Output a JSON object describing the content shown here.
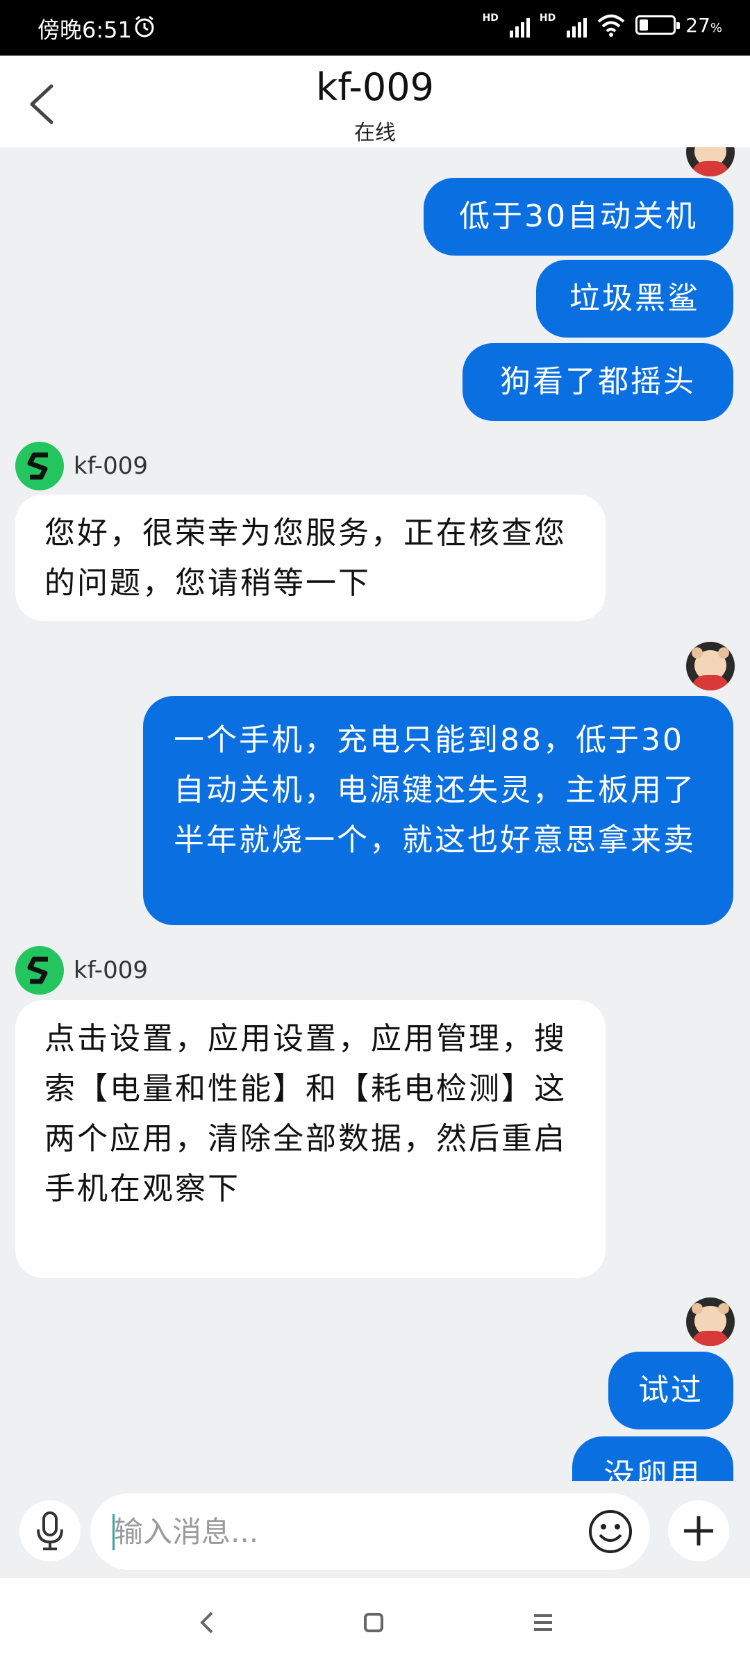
{
  "status": {
    "time": "傍晚6:51",
    "network_1": "HD",
    "network_2": "HD",
    "battery": "27",
    "battery_unit": "%",
    "battery_level": 0.27
  },
  "header": {
    "title": "kf-009",
    "subtitle": "在线"
  },
  "messages": [
    {
      "from": "me",
      "text": "低于30自动关机"
    },
    {
      "from": "me",
      "text": "垃圾黑鲨"
    },
    {
      "from": "me",
      "text": "狗看了都摇头"
    },
    {
      "from": "agent",
      "name": "kf-009",
      "text": "您好，很荣幸为您服务，正在核查您的问题，您请稍等一下"
    },
    {
      "from": "me",
      "text": "一个手机，充电只能到88，低于30自动关机，电源键还失灵，主板用了半年就烧一个，就这也好意思拿来卖"
    },
    {
      "from": "agent",
      "name": "kf-009",
      "text": "点击设置，应用设置，应用管理，搜索【电量和性能】和【耗电检测】这两个应用，清除全部数据，然后重启手机在观察下"
    },
    {
      "from": "me",
      "text": "试过"
    },
    {
      "from": "me",
      "text": "没卵用"
    }
  ],
  "input": {
    "placeholder": "输入消息..."
  },
  "icons": {
    "back": "chevron-left-icon",
    "mic": "microphone-icon",
    "emoji": "emoji-icon",
    "plus": "plus-icon",
    "nav_back": "nav-back-icon",
    "nav_home": "nav-home-icon",
    "nav_menu": "nav-menu-icon"
  },
  "colors": {
    "outgoing_bubble": "#0a6fe0",
    "agent_logo": "#22c55e",
    "background": "#eff0f2"
  }
}
